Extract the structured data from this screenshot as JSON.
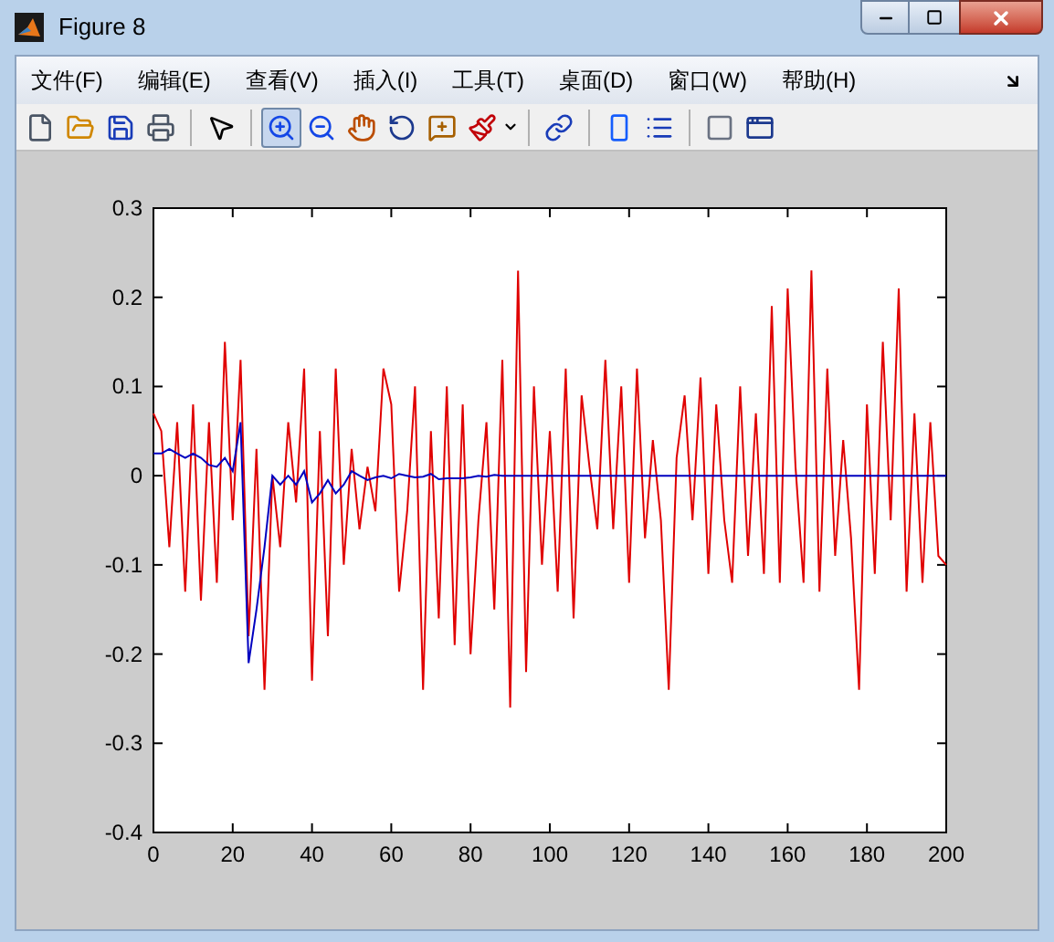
{
  "window": {
    "title": "Figure 8"
  },
  "menu": [
    "文件(F)",
    "编辑(E)",
    "查看(V)",
    "插入(I)",
    "工具(T)",
    "桌面(D)",
    "窗口(W)",
    "帮助(H)"
  ],
  "toolbar": [
    {
      "selected": false
    },
    {
      "selected": false
    },
    {
      "selected": false
    },
    {
      "selected": false
    },
    {
      "selected": false
    },
    {
      "selected": true
    },
    {
      "selected": false
    },
    {
      "selected": false
    },
    {
      "selected": false
    },
    {
      "selected": false
    },
    {
      "selected": false
    },
    {
      "selected": false
    },
    {
      "selected": false
    },
    {
      "selected": false
    },
    {
      "selected": false
    },
    {
      "selected": false
    }
  ],
  "figure": {
    "chart_data": {
      "type": "line",
      "xlim": [
        0,
        200
      ],
      "ylim": [
        -0.4,
        0.3
      ],
      "xticks": [
        0,
        20,
        40,
        60,
        80,
        100,
        120,
        140,
        160,
        180,
        200
      ],
      "yticks": [
        -0.4,
        -0.3,
        -0.2,
        -0.1,
        0,
        0.1,
        0.2,
        0.3
      ],
      "x": [
        0,
        2,
        4,
        6,
        8,
        10,
        12,
        14,
        16,
        18,
        20,
        22,
        24,
        26,
        28,
        30,
        32,
        34,
        36,
        38,
        40,
        42,
        44,
        46,
        48,
        50,
        52,
        54,
        56,
        58,
        60,
        62,
        64,
        66,
        68,
        70,
        72,
        74,
        76,
        78,
        80,
        82,
        84,
        86,
        88,
        90,
        92,
        94,
        96,
        98,
        100,
        102,
        104,
        106,
        108,
        110,
        112,
        114,
        116,
        118,
        120,
        122,
        124,
        126,
        128,
        130,
        132,
        134,
        136,
        138,
        140,
        142,
        144,
        146,
        148,
        150,
        152,
        154,
        156,
        158,
        160,
        162,
        164,
        166,
        168,
        170,
        172,
        174,
        176,
        178,
        180,
        182,
        184,
        186,
        188,
        190,
        192,
        194,
        196,
        198,
        200
      ],
      "series": [
        {
          "color": "#e00000",
          "values": [
            0.07,
            0.05,
            -0.08,
            0.06,
            -0.13,
            0.08,
            -0.14,
            0.06,
            -0.12,
            0.15,
            -0.05,
            0.13,
            -0.18,
            0.03,
            -0.24,
            0.0,
            -0.08,
            0.06,
            -0.03,
            0.12,
            -0.23,
            0.05,
            -0.18,
            0.12,
            -0.1,
            0.03,
            -0.06,
            0.01,
            -0.04,
            0.12,
            0.08,
            -0.13,
            -0.04,
            0.1,
            -0.24,
            0.05,
            -0.16,
            0.1,
            -0.19,
            0.08,
            -0.2,
            -0.05,
            0.06,
            -0.15,
            0.13,
            -0.26,
            0.23,
            -0.22,
            0.1,
            -0.1,
            0.05,
            -0.13,
            0.12,
            -0.16,
            0.09,
            0.01,
            -0.06,
            0.13,
            -0.06,
            0.1,
            -0.12,
            0.12,
            -0.07,
            0.04,
            -0.05,
            -0.24,
            0.02,
            0.09,
            -0.05,
            0.11,
            -0.11,
            0.08,
            -0.05,
            -0.12,
            0.1,
            -0.09,
            0.07,
            -0.11,
            0.19,
            -0.12,
            0.21,
            0.01,
            -0.12,
            0.23,
            -0.13,
            0.12,
            -0.09,
            0.04,
            -0.07,
            -0.24,
            0.08,
            -0.11,
            0.15,
            -0.05,
            0.21,
            -0.13,
            0.07,
            -0.12,
            0.06,
            -0.09,
            -0.1
          ]
        },
        {
          "color": "#0000c0",
          "values": [
            0.025,
            0.025,
            0.03,
            0.025,
            0.02,
            0.025,
            0.02,
            0.012,
            0.01,
            0.02,
            0.005,
            0.06,
            -0.21,
            -0.15,
            -0.08,
            0.0,
            -0.01,
            0.0,
            -0.01,
            0.005,
            -0.03,
            -0.02,
            -0.005,
            -0.02,
            -0.01,
            0.005,
            0.0,
            -0.005,
            -0.002,
            0.0,
            -0.003,
            0.002,
            0.0,
            -0.002,
            -0.001,
            0.002,
            -0.004,
            -0.003,
            -0.003,
            -0.003,
            -0.002,
            0.0,
            -0.001,
            0.001,
            0.0,
            0.0,
            0.0,
            0.0,
            0.0,
            0.0,
            0.0,
            0.0,
            0.0,
            0.0,
            0.0,
            0.0,
            0.0,
            0.0,
            0.0,
            0.0,
            0.0,
            0.0,
            0.0,
            0.0,
            0.0,
            0.0,
            0.0,
            0.0,
            0.0,
            0.0,
            0.0,
            0.0,
            0.0,
            0.0,
            0.0,
            0.0,
            0.0,
            0.0,
            0.0,
            0.0,
            0.0,
            0.0,
            0.0,
            0.0,
            0.0,
            0.0,
            0.0,
            0.0,
            0.0,
            0.0,
            0.0,
            0.0,
            0.0,
            0.0,
            0.0,
            0.0,
            0.0,
            0.0,
            0.0,
            0.0,
            0.0
          ]
        }
      ]
    }
  }
}
